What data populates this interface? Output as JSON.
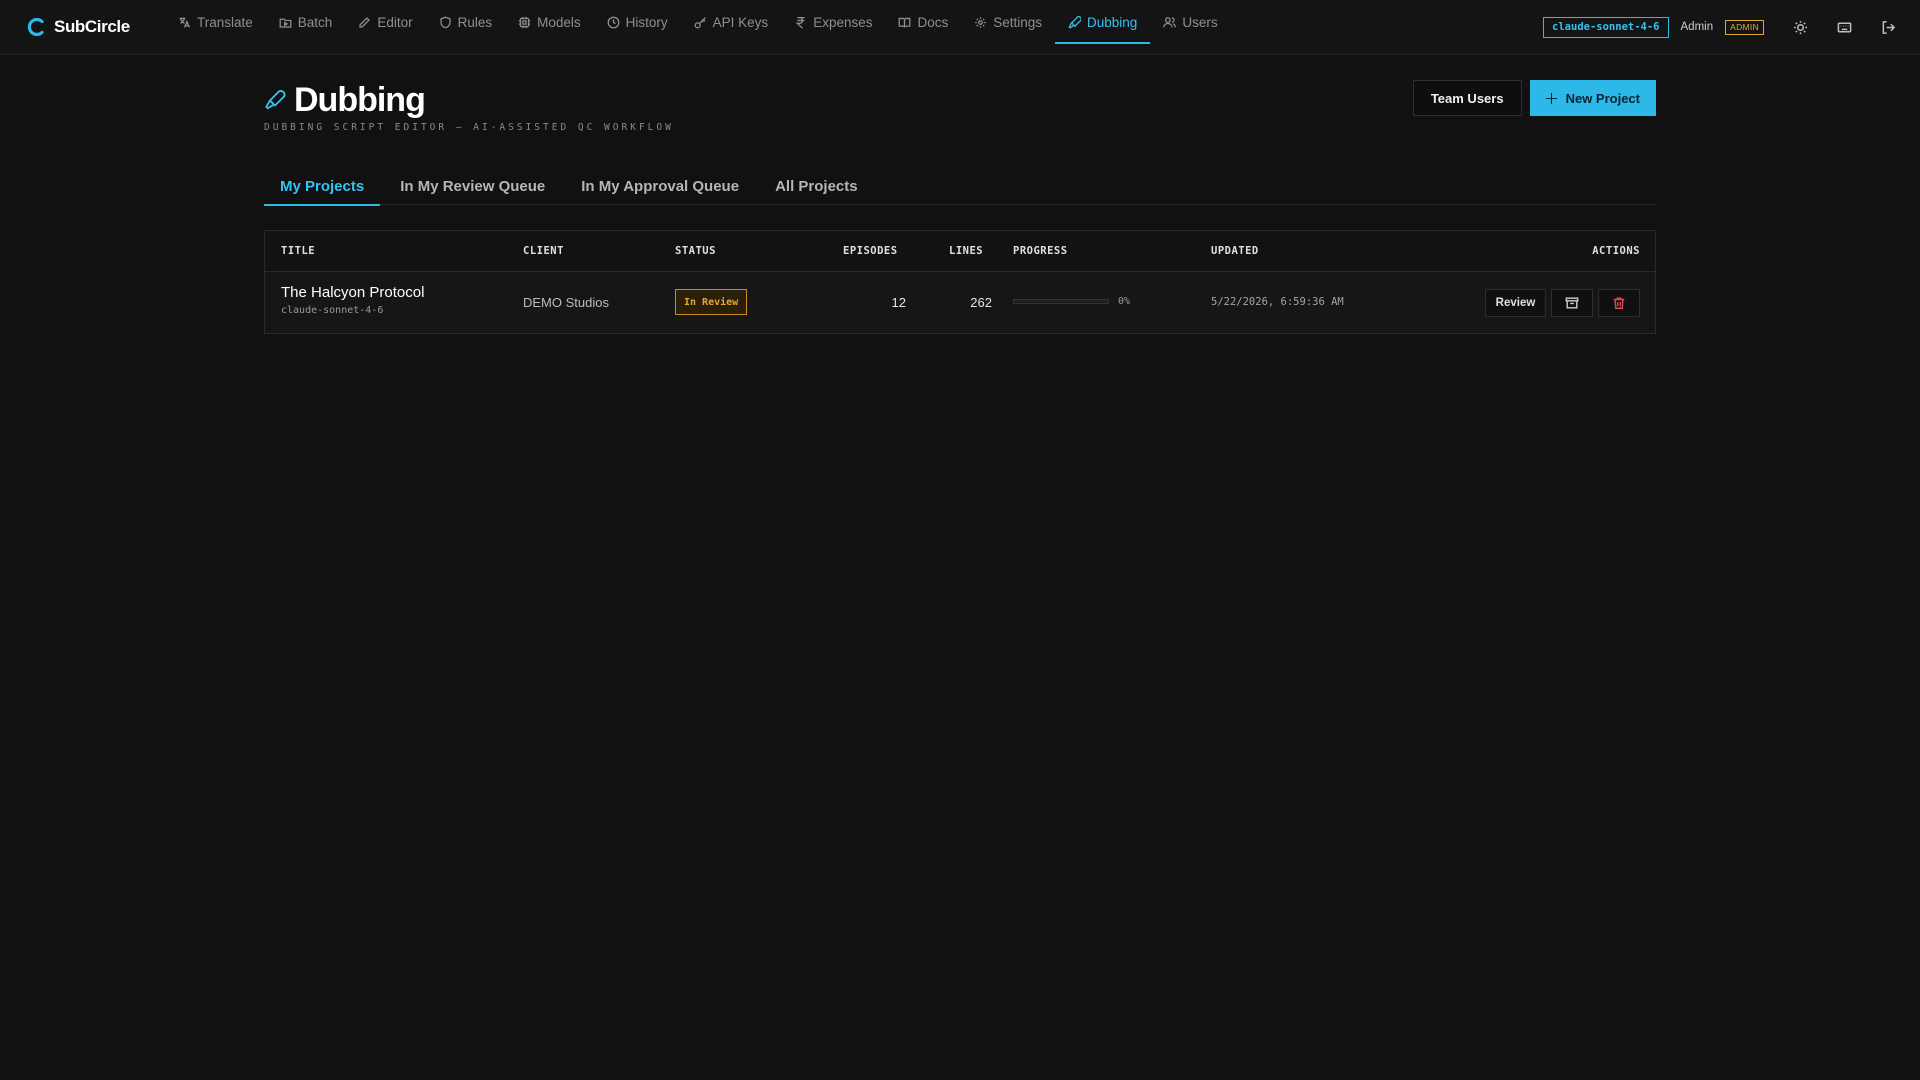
{
  "app": {
    "name": "SubCircle",
    "accent": "#2cb8e8"
  },
  "nav": {
    "items": [
      {
        "label": "Translate",
        "icon": "translate-icon"
      },
      {
        "label": "Batch",
        "icon": "folder-play-icon"
      },
      {
        "label": "Editor",
        "icon": "pencil-icon"
      },
      {
        "label": "Rules",
        "icon": "shield-icon"
      },
      {
        "label": "Models",
        "icon": "cpu-icon"
      },
      {
        "label": "History",
        "icon": "clock-icon"
      },
      {
        "label": "API Keys",
        "icon": "key-icon"
      },
      {
        "label": "Expenses",
        "icon": "rupee-icon"
      },
      {
        "label": "Docs",
        "icon": "book-icon"
      },
      {
        "label": "Settings",
        "icon": "gear-icon"
      },
      {
        "label": "Dubbing",
        "icon": "microphone-icon",
        "active": true
      },
      {
        "label": "Users",
        "icon": "users-icon"
      }
    ]
  },
  "topbar": {
    "model": "claude-sonnet-4-6",
    "user_name": "Admin",
    "role_badge": "ADMIN"
  },
  "page": {
    "title": "Dubbing",
    "subtitle": "DUBBING SCRIPT EDITOR — AI-ASSISTED QC WORKFLOW",
    "team_users_label": "Team Users",
    "new_project_label": "New Project"
  },
  "tabs": [
    {
      "label": "My Projects",
      "active": true
    },
    {
      "label": "In My Review Queue"
    },
    {
      "label": "In My Approval Queue"
    },
    {
      "label": "All Projects"
    }
  ],
  "table": {
    "columns": [
      "TITLE",
      "CLIENT",
      "STATUS",
      "EPISODES",
      "LINES",
      "PROGRESS",
      "UPDATED",
      "ACTIONS"
    ],
    "rows": [
      {
        "title": "The Halcyon Protocol",
        "model": "claude-sonnet-4-6",
        "client": "DEMO Studios",
        "status": "In Review",
        "episodes": "12",
        "lines": "262",
        "progress_label": "0%",
        "progress": 0,
        "updated": "5/22/2026, 6:59:36 AM",
        "review_label": "Review"
      }
    ]
  }
}
